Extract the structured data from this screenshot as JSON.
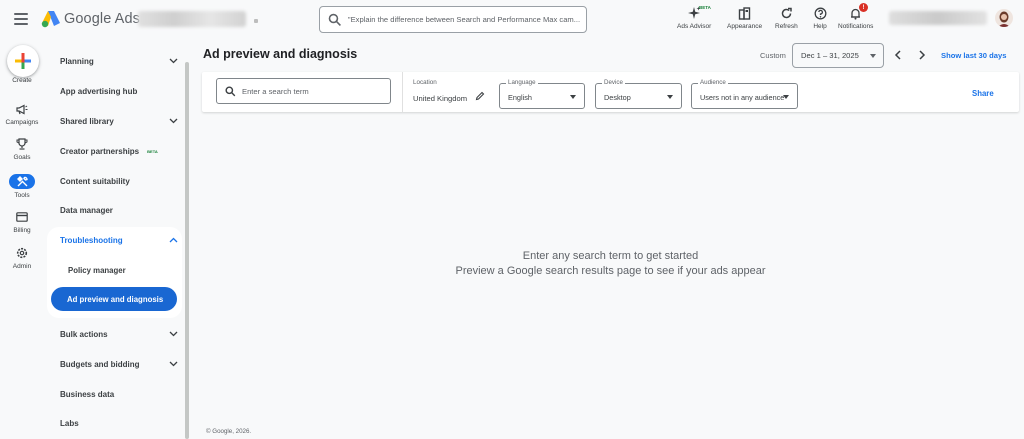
{
  "header": {
    "brand": "Google Ads",
    "search_placeholder": "\"Explain the difference between Search and Performance Max cam...",
    "tools": [
      {
        "label": "Ads Advisor",
        "badge": "BETA"
      },
      {
        "label": "Appearance"
      },
      {
        "label": "Refresh"
      },
      {
        "label": "Help"
      },
      {
        "label": "Notifications",
        "badge": "!"
      }
    ]
  },
  "rail": {
    "create_label": "Create",
    "items": [
      {
        "label": "Campaigns",
        "icon": "megaphone-icon"
      },
      {
        "label": "Goals",
        "icon": "trophy-icon"
      },
      {
        "label": "Tools",
        "icon": "tools-icon",
        "active": true
      },
      {
        "label": "Billing",
        "icon": "credit-card-icon"
      },
      {
        "label": "Admin",
        "icon": "gear-icon"
      }
    ]
  },
  "nav": {
    "items": [
      {
        "label": "Planning",
        "expandable": true
      },
      {
        "label": "App advertising hub"
      },
      {
        "label": "Shared library",
        "expandable": true
      },
      {
        "label": "Creator partnerships",
        "badge": "BETA"
      },
      {
        "label": "Content suitability"
      },
      {
        "label": "Data manager"
      }
    ],
    "troubleshooting": {
      "label": "Troubleshooting",
      "sub_items": [
        "Policy manager",
        "Ad preview and diagnosis"
      ],
      "active_sub": "Ad preview and diagnosis"
    },
    "after_items": [
      {
        "label": "Bulk actions",
        "expandable": true
      },
      {
        "label": "Budgets and bidding",
        "expandable": true
      },
      {
        "label": "Business data"
      },
      {
        "label": "Labs"
      }
    ]
  },
  "main": {
    "title": "Ad preview and diagnosis",
    "date_prefix": "Custom",
    "date_range": "Dec 1 – 31, 2025",
    "show_last": "Show last 30 days",
    "filters": {
      "search_placeholder": "Enter a search term",
      "location_label": "Location",
      "location_value": "United Kingdom",
      "language_label": "Language",
      "language_value": "English",
      "device_label": "Device",
      "device_value": "Desktop",
      "audience_label": "Audience",
      "audience_value": "Users not in any audience",
      "share_label": "Share"
    },
    "empty_state": {
      "line1": "Enter any search term to get started",
      "line2": "Preview a Google search results page to see if your ads appear"
    },
    "footer": "© Google, 2026."
  },
  "colors": {
    "accent": "#1a73e8",
    "active_nav": "#1967d2",
    "beta": "#188038",
    "notification": "#d93025"
  }
}
